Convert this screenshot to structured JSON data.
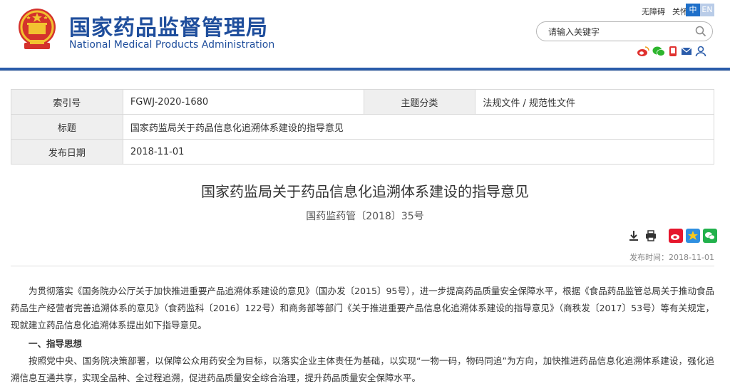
{
  "header": {
    "brand_cn": "国家药品监督管理局",
    "brand_en": "National Medical Products Administration",
    "links": [
      "无障碍",
      "关怀版"
    ],
    "lang": {
      "zh": "中",
      "en": "EN"
    },
    "search_placeholder": "请输入关键字",
    "social_icons": [
      "weibo-icon",
      "wechat-icon",
      "phone-icon",
      "mail-icon",
      "user-icon"
    ],
    "colors": {
      "brand": "#1f4e9c",
      "rule": "#2a5caa",
      "lang_active": "#1e6fc9"
    }
  },
  "meta": {
    "index_label": "索引号",
    "index_value": "FGWJ-2020-1680",
    "topic_label": "主题分类",
    "topic_value": "法规文件 / 规范性文件",
    "title_label": "标题",
    "title_value": "国家药监局关于药品信息化追溯体系建设的指导意见",
    "date_label": "发布日期",
    "date_value": "2018-11-01"
  },
  "document": {
    "title": "国家药监局关于药品信息化追溯体系建设的指导意见",
    "number": "国药监药管〔2018〕35号",
    "tool_icons": [
      "download-icon",
      "print-icon"
    ],
    "share_icons": [
      "weibo-share-icon",
      "qzone-share-icon",
      "wechat-share-icon"
    ],
    "pubtime": "发布时间：2018-11-01",
    "paragraph1": "为贯彻落实《国务院办公厅关于加快推进重要产品追溯体系建设的意见》（国办发〔2015〕95号），进一步提高药品质量安全保障水平，根据《食品药品监管总局关于推动食品药品生产经营者完善追溯体系的意见》（食药监科〔2016〕122号）和商务部等部门《关于推进重要产品信息化追溯体系建设的指导意见》（商秩发〔2017〕53号）等有关规定，现就建立药品信息化追溯体系提出如下指导意见。",
    "heading1": "一、指导思想",
    "paragraph2": "按照党中央、国务院决策部署，以保障公众用药安全为目标，以落实企业主体责任为基础，以实现“一物一码，物码同追”为方向，加快推进药品信息化追溯体系建设，强化追溯信息互通共享，实现全品种、全过程追溯，促进药品质量安全综合治理，提升药品质量安全保障水平。"
  }
}
